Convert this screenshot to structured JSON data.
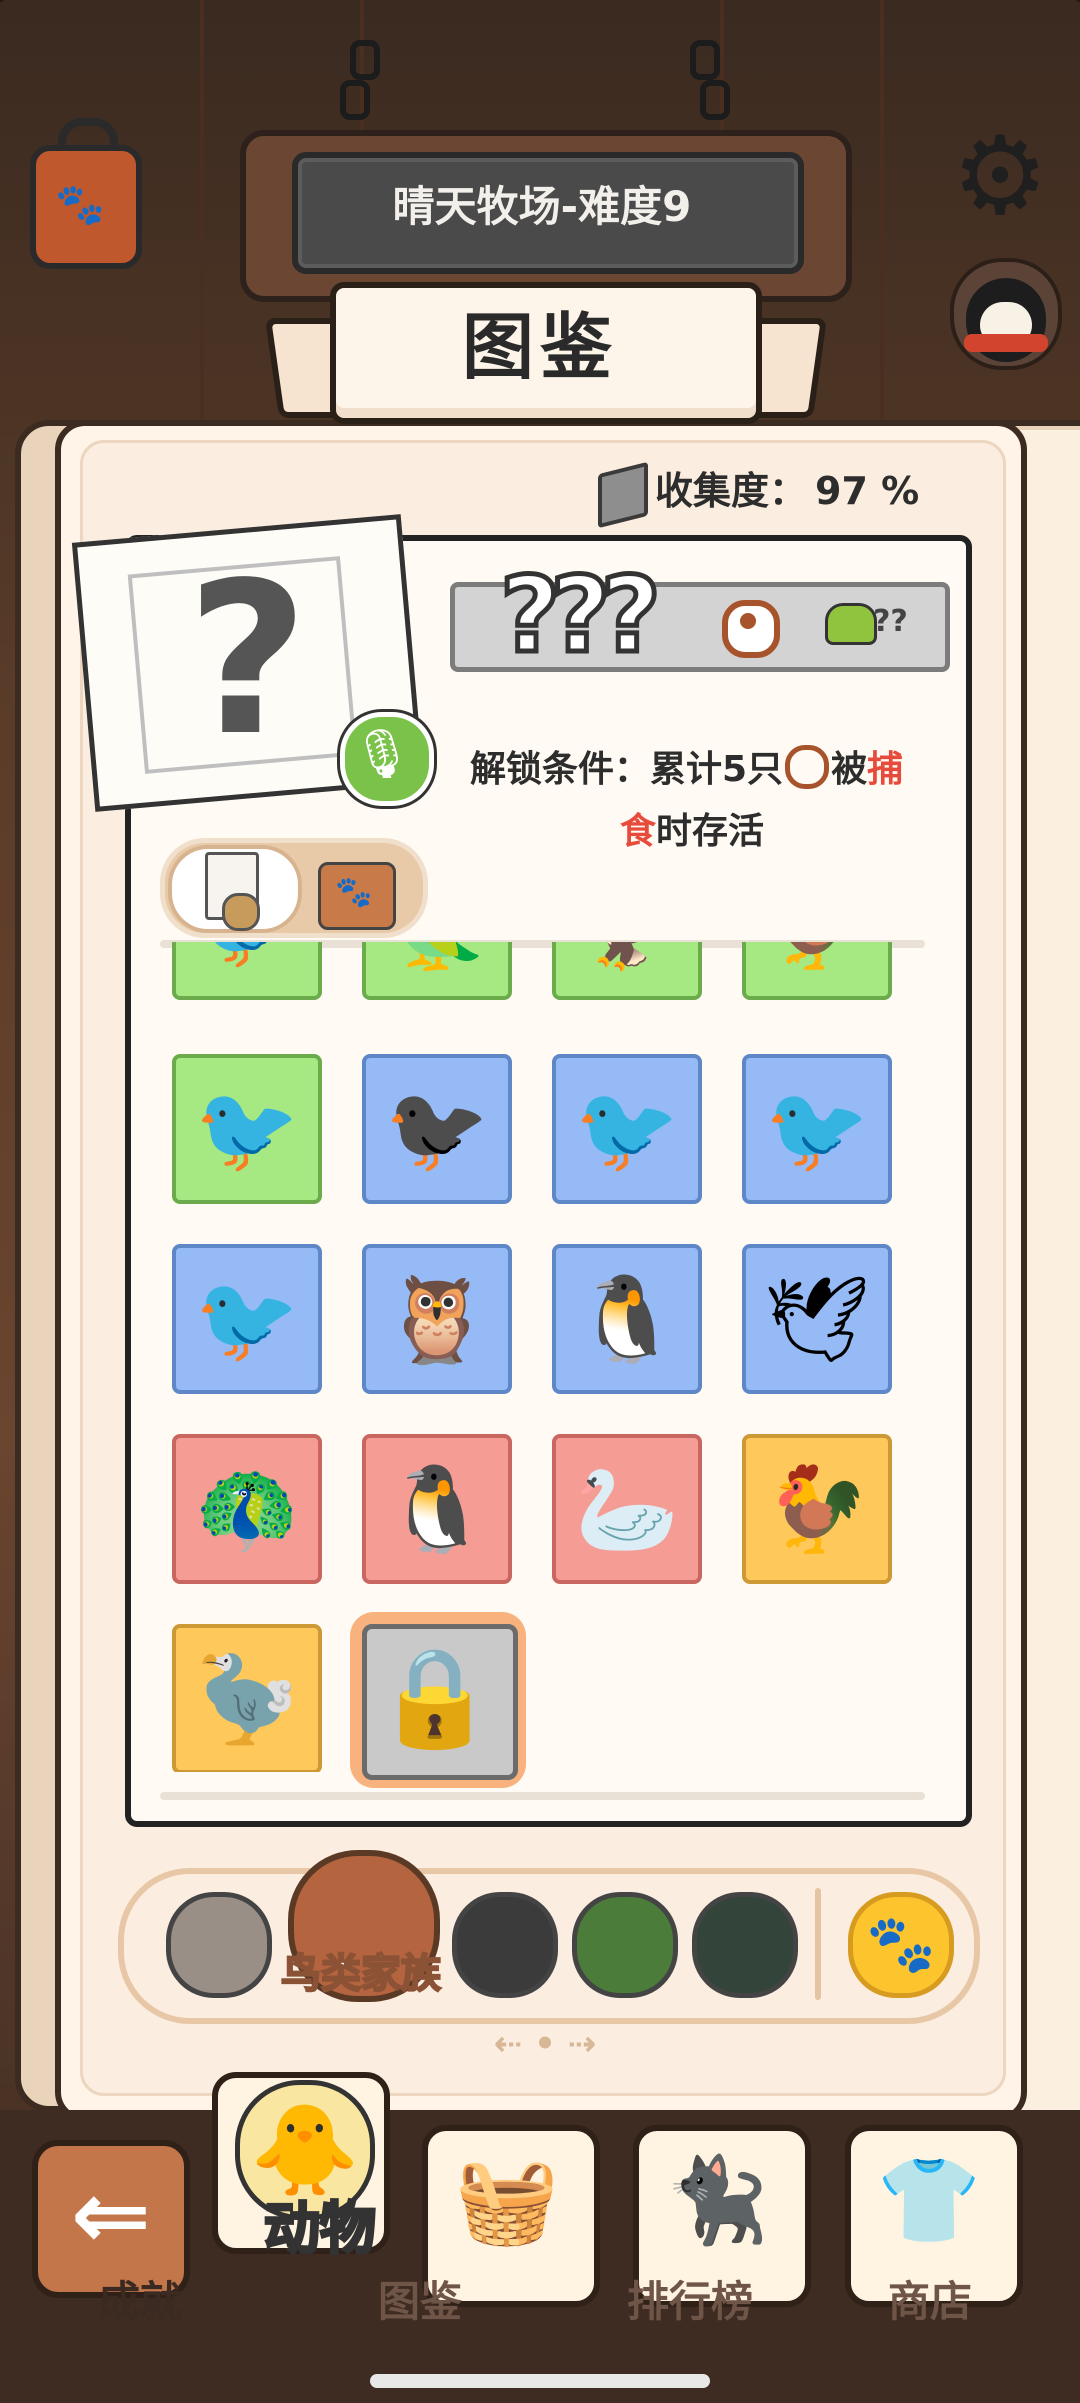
{
  "header": {
    "farm_title": "晴天牧场-难度9",
    "banner_title": "图鉴"
  },
  "collection": {
    "label": "收集度：",
    "value": "97 %"
  },
  "detail": {
    "name": "???",
    "food_count": "??",
    "unlock_prefix": "解锁条件：累计5只",
    "unlock_mid": "被",
    "unlock_red": "捕",
    "unlock_red2": "食",
    "unlock_suffix": "时存活"
  },
  "grid": {
    "rows": [
      [
        {
          "color": "g",
          "icon": "bird-grey"
        },
        {
          "color": "g",
          "icon": "parrot"
        },
        {
          "color": "g",
          "icon": "eagle"
        },
        {
          "color": "g",
          "icon": "rooster"
        }
      ],
      [
        {
          "color": "g",
          "icon": "puffin"
        },
        {
          "color": "b",
          "icon": "magpie"
        },
        {
          "color": "b",
          "icon": "hornbill"
        },
        {
          "color": "b",
          "icon": "toucan"
        }
      ],
      [
        {
          "color": "b",
          "icon": "ostrich"
        },
        {
          "color": "b",
          "icon": "owl"
        },
        {
          "color": "b",
          "icon": "baby-penguin"
        },
        {
          "color": "b",
          "icon": "snowy-owl"
        }
      ],
      [
        {
          "color": "r",
          "icon": "peacock"
        },
        {
          "color": "r",
          "icon": "penguin"
        },
        {
          "color": "r",
          "icon": "pelican"
        },
        {
          "color": "y",
          "icon": "fire-rooster"
        }
      ],
      [
        {
          "color": "y",
          "icon": "blue-phoenix"
        },
        {
          "color": "locked",
          "icon": "lock"
        }
      ]
    ]
  },
  "categories": {
    "active_label": "鸟类家族",
    "items": [
      "mammal-icon",
      "bird-icon",
      "shark-icon",
      "frog-icon",
      "turtle-icon",
      "paw-icon"
    ]
  },
  "nav": {
    "achievements": "成就",
    "animals": "动物",
    "collection": "图鉴",
    "ranking": "排行榜",
    "shop": "商店"
  },
  "colors": {
    "accent": "#c27649",
    "green_cell": "#a6e982",
    "blue_cell": "#95baf6",
    "red_cell": "#f59c95",
    "yellow_cell": "#ffc85a",
    "unlock_red": "#e74b3c"
  }
}
